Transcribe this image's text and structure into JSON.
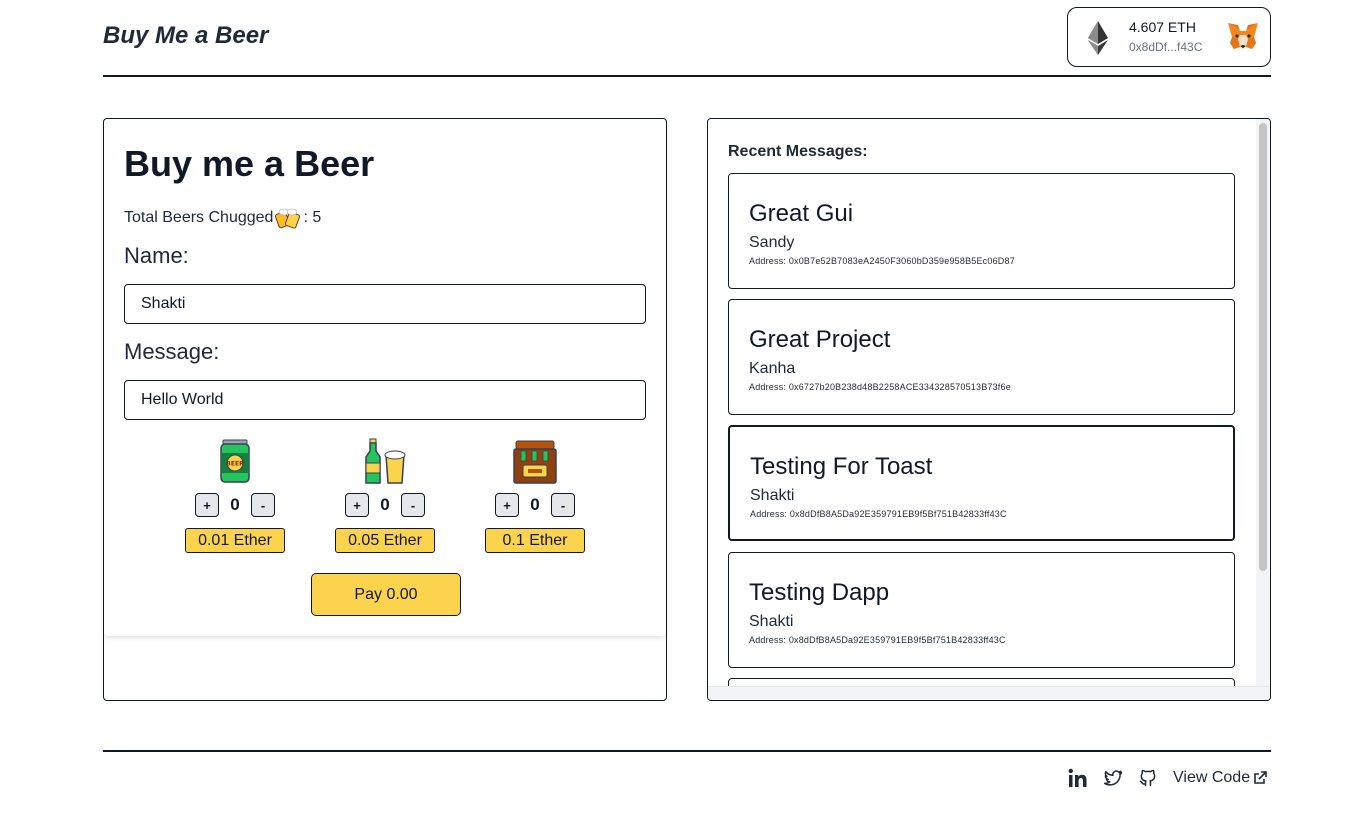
{
  "header": {
    "brand": "Buy Me a Beer",
    "wallet": {
      "balance": "4.607 ETH",
      "address": "0x8dDf...f43C"
    }
  },
  "form": {
    "title": "Buy me a Beer",
    "total_label": "Total Beers Chugged",
    "total_value": ": 5",
    "name_label": "Name:",
    "name_value": "Shakti",
    "message_label": "Message:",
    "message_value": "Hello World",
    "items": [
      {
        "icon": "beer-can-icon",
        "plus": "+",
        "count": "0",
        "minus": "-",
        "price": "0.01 Ether"
      },
      {
        "icon": "beer-bottle-glass-icon",
        "plus": "+",
        "count": "0",
        "minus": "-",
        "price": "0.05 Ether"
      },
      {
        "icon": "six-pack-icon",
        "plus": "+",
        "count": "0",
        "minus": "-",
        "price": "0.1 Ether"
      }
    ],
    "pay_label": "Pay 0.00"
  },
  "messages": {
    "title": "Recent Messages:",
    "list": [
      {
        "title": "Great Gui",
        "name": "Sandy",
        "address": "Address: 0x0B7e52B7083eA2450F3060bD359e958B5Ec06D87"
      },
      {
        "title": "Great Project",
        "name": "Kanha",
        "address": "Address: 0x6727b20B238d48B2258ACE334328570513B73f6e"
      },
      {
        "title": "Testing For Toast",
        "name": "Shakti",
        "address": "Address: 0x8dDfB8A5Da92E359791EB9f5Bf751B42833ff43C"
      },
      {
        "title": "Testing Dapp",
        "name": "Shakti",
        "address": "Address: 0x8dDfB8A5Da92E359791EB9f5Bf751B42833ff43C"
      }
    ]
  },
  "footer": {
    "view_code": "View Code"
  },
  "colors": {
    "accent": "#fcd34d",
    "border": "#111827",
    "text": "#1f2937"
  }
}
